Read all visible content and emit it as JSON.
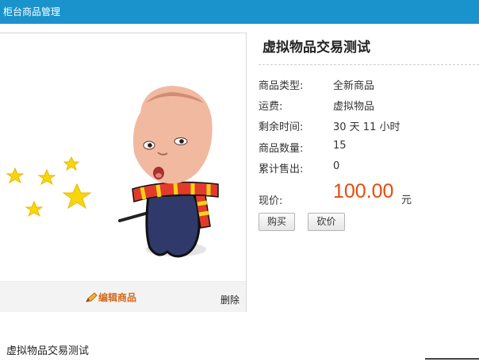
{
  "header": {
    "title": "柜台商品管理",
    "bg_color": "#1a93cc"
  },
  "product": {
    "title": "虚拟物品交易测试",
    "type_label": "商品类型:",
    "type_value": "全新商品",
    "shipping_label": "运费:",
    "shipping_value": "虚拟物品",
    "remaining_label": "剩余时间:",
    "remaining_value": "30 天 11 小时",
    "quantity_label": "商品数量:",
    "quantity_value": "15",
    "sold_label": "累计售出:",
    "sold_value": "0",
    "price_label": "现价:",
    "price_value": "100.00",
    "price_unit": "元",
    "price_color": "#e84b0c"
  },
  "buttons": {
    "buy": "购买",
    "bargain": "砍价"
  },
  "image_actions": {
    "edit": "编辑商品",
    "delete": "删除",
    "edit_color": "#d46a1e"
  },
  "footer": {
    "title": "虚拟物品交易测试"
  },
  "icons": {
    "edit": "pencil-icon",
    "image": "baby-cartoon-image"
  }
}
